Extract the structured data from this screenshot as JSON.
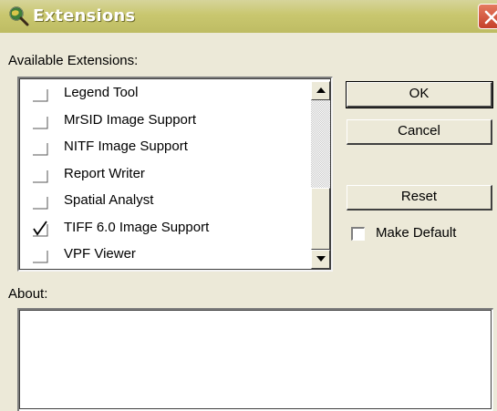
{
  "window": {
    "title": "Extensions",
    "close_icon": "close-icon"
  },
  "available_label": "Available Extensions:",
  "extensions": [
    {
      "label": "Legend Tool",
      "checked": false
    },
    {
      "label": "MrSID Image Support",
      "checked": false
    },
    {
      "label": "NITF Image Support",
      "checked": false
    },
    {
      "label": "Report Writer",
      "checked": false
    },
    {
      "label": "Spatial Analyst",
      "checked": false
    },
    {
      "label": "TIFF 6.0 Image Support",
      "checked": true
    },
    {
      "label": "VPF Viewer",
      "checked": false
    }
  ],
  "buttons": {
    "ok": "OK",
    "cancel": "Cancel",
    "reset": "Reset"
  },
  "make_default": {
    "label": "Make Default",
    "checked": false
  },
  "about_label": "About:",
  "about_text": "",
  "colors": {
    "titlebar": "#c9c76f",
    "dialog_bg": "#ece9d8",
    "close_button": "#d4553d"
  }
}
